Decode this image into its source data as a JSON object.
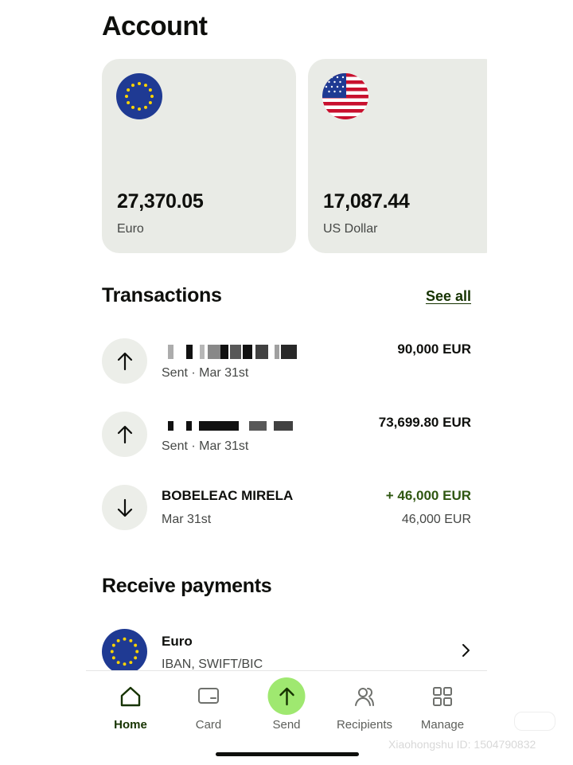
{
  "header": {
    "title": "Account"
  },
  "accounts": [
    {
      "amount": "27,370.05",
      "currency": "Euro",
      "flag": "eu-flag-icon"
    },
    {
      "amount": "17,087.44",
      "currency": "US Dollar",
      "flag": "us-flag-icon"
    }
  ],
  "transactions_section": {
    "title": "Transactions",
    "see_all": "See all"
  },
  "transactions": [
    {
      "name": "",
      "redacted": true,
      "sub": "Sent · Mar 31st",
      "amount": "90,000 EUR",
      "direction": "out"
    },
    {
      "name": "",
      "redacted": true,
      "sub": "Sent · Mar 31st",
      "amount": "73,699.80 EUR",
      "direction": "out"
    },
    {
      "name": "BOBELEAC MIRELA",
      "redacted": false,
      "sub": "Mar 31st",
      "amount": "+ 46,000 EUR",
      "amount_secondary": "46,000 EUR",
      "direction": "in"
    }
  ],
  "receive_section": {
    "title": "Receive payments",
    "item": {
      "title": "Euro",
      "sub": "IBAN, SWIFT/BIC"
    }
  },
  "tabbar": {
    "home": "Home",
    "card": "Card",
    "send": "Send",
    "recipients": "Recipients",
    "manage": "Manage"
  },
  "watermark": "Xiaohongshu ID: 1504790832",
  "colors": {
    "accent_green": "#9fe870",
    "dark_green": "#163300",
    "positive": "#2f5711",
    "card_bg": "#e9ebe6"
  }
}
